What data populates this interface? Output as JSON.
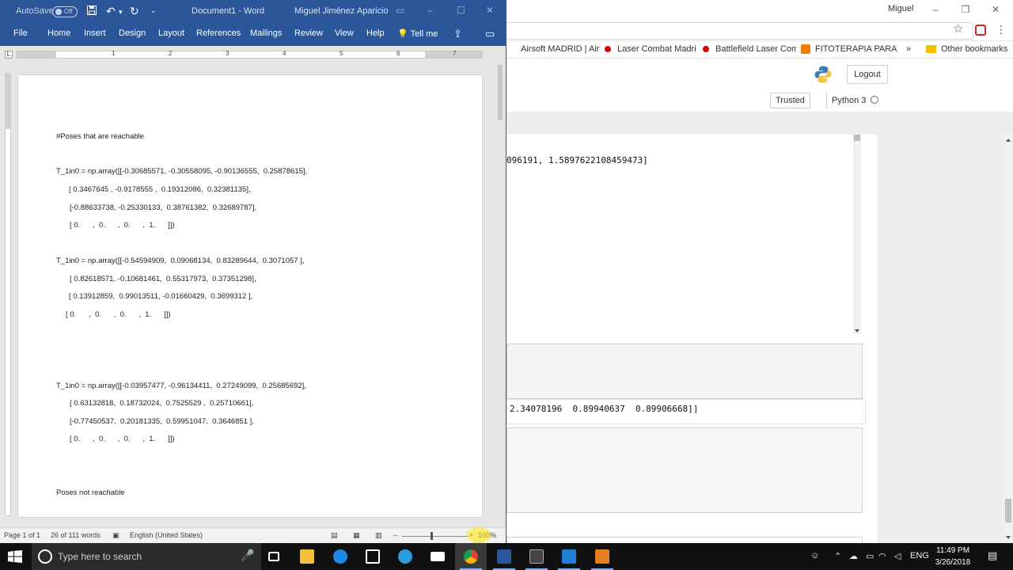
{
  "chrome": {
    "user": "Miguel",
    "bookmarks": [
      "Airsoft MADRID | Air",
      "Laser Combat Madrid",
      "Battlefield Laser Com",
      "FITOTERAPIA PARA L",
      "»",
      "Other bookmarks"
    ],
    "logout_label": "Logout",
    "trusted_label": "Trusted",
    "kernel_label": "Python 3",
    "output_1": "096191, 1.5897622108459473]",
    "output_2": "2.34078196  0.89940637  0.89906668]]"
  },
  "word": {
    "autosave_label": "AutoSave",
    "toggle_label": "Off",
    "title": "Document1 - Word",
    "user": "Miguel Jiménez Aparicio",
    "tabs": [
      "File",
      "Home",
      "Insert",
      "Design",
      "Layout",
      "References",
      "Mailings",
      "Review",
      "View",
      "Help"
    ],
    "tell_me": "Tell me",
    "ruler_numbers": [
      "1",
      "2",
      "3",
      "4",
      "5",
      "6",
      "7"
    ],
    "doc": {
      "heading_reachable": "#Poses that are reachable",
      "block1": [
        "T_1in0 = np.array([[-0.30685571, -0.30558095, -0.90136555,  0.25878615],",
        "[ 0.3467645 , -0.9178555 ,  0.19312086,  0.32381135],",
        "[-0.88633738, -0.25330133,  0.38761382,  0.32689787],",
        "[ 0.      ,  0.      ,  0.      ,  1.      ]])"
      ],
      "block2": [
        "T_1in0 = np.array([[-0.54594909,  0.09068134,  0.83289644,  0.3071057 ],",
        "[ 0.82618571, -0.10681461,  0.55317973,  0.37351298],",
        "[ 0.13912859,  0.99013511, -0.01660429,  0.3699312 ],",
        "[ 0.      ,  0.      ,  0.      ,  1.      ]])"
      ],
      "block3": [
        "T_1in0 = np.array([[-0.03957477, -0.96134411,  0.27249099,  0.25685692],",
        "[ 0.63132818,  0.18732024,  0.7525529 ,  0.25710661],",
        "[-0.77450537,  0.20181335,  0.59951047,  0.3646851 ],",
        "[ 0.      ,  0.      ,  0.      ,  1.      ]])"
      ],
      "heading_not_reachable": "Poses not reachable"
    },
    "status": {
      "page": "Page 1 of 1",
      "words": "26 of 111 words",
      "language": "English (United States)",
      "zoom": "100%"
    }
  },
  "taskbar": {
    "search_placeholder": "Type here to search",
    "lang": "ENG",
    "time": "11:49 PM",
    "date": "3/26/2018"
  },
  "colors": {
    "word_blue": "#2b579a",
    "taskbar": "#101010"
  }
}
